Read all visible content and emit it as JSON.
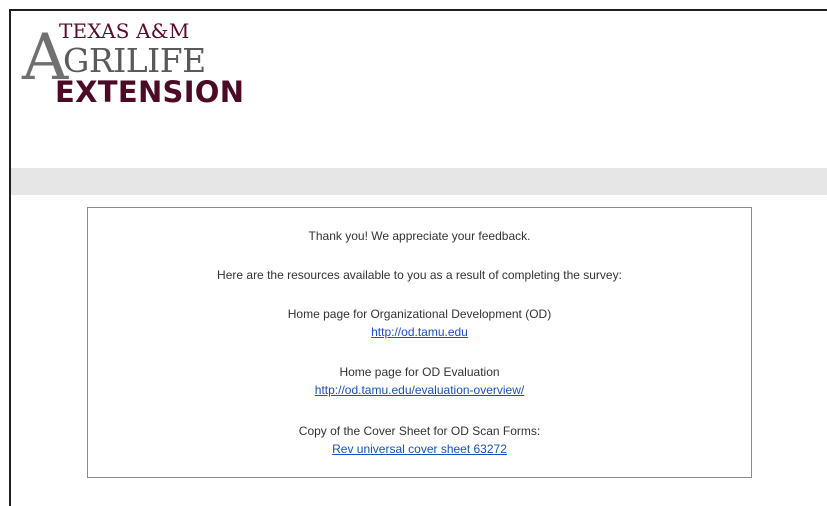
{
  "logo": {
    "line1": "TEXAS A&M",
    "big_letter": "A",
    "line2": "GRILIFE",
    "line3": "EXTENSION"
  },
  "message": {
    "thanks": "Thank you! We appreciate your feedback.",
    "intro": "Here are the resources available to you as a result of completing the survey:"
  },
  "resources": [
    {
      "label": "Home page for Organizational Development (OD)",
      "link_text": "http://od.tamu.edu"
    },
    {
      "label": "Home page for OD Evaluation",
      "link_text": "http://od.tamu.edu/evaluation-overview/"
    },
    {
      "label": "Copy of the Cover Sheet for OD Scan Forms:",
      "link_text": "Rev universal cover sheet 63272"
    }
  ],
  "colors": {
    "brand_maroon": "#500000",
    "link_blue": "#1a4fc4",
    "band_grey": "#e6e6e6"
  }
}
